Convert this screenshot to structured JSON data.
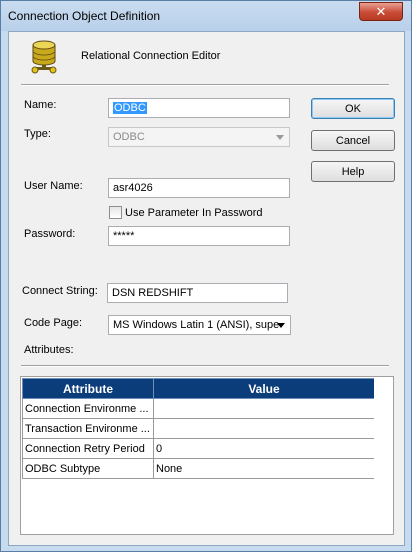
{
  "window": {
    "title": "Connection Object Definition",
    "close_glyph": "✕"
  },
  "header": {
    "title": "Relational Connection Editor",
    "icon": "database-icon"
  },
  "form": {
    "name_label": "Name:",
    "name_value": "ODBC",
    "type_label": "Type:",
    "type_value": "ODBC",
    "username_label": "User Name:",
    "username_value": "asr4026",
    "use_param_label": "Use Parameter In Password",
    "use_param_checked": false,
    "password_label": "Password:",
    "password_value": "*****",
    "connect_string_label": "Connect String:",
    "connect_string_value": "DSN REDSHIFT",
    "code_page_label": "Code Page:",
    "code_page_value": "MS Windows Latin 1 (ANSI), supe",
    "attributes_label": "Attributes:"
  },
  "buttons": {
    "ok": "OK",
    "cancel": "Cancel",
    "help": "Help"
  },
  "attributes_table": {
    "headers": [
      "Attribute",
      "Value"
    ],
    "rows": [
      [
        "Connection Environment SQL",
        ""
      ],
      [
        "Transaction Environment SQL",
        ""
      ],
      [
        "Connection Retry Period",
        "0"
      ],
      [
        "ODBC Subtype",
        "None"
      ]
    ]
  },
  "colors": {
    "table_header_bg": "#0b3d7b",
    "selection": "#3399ff",
    "frame": "#c7dbef"
  }
}
